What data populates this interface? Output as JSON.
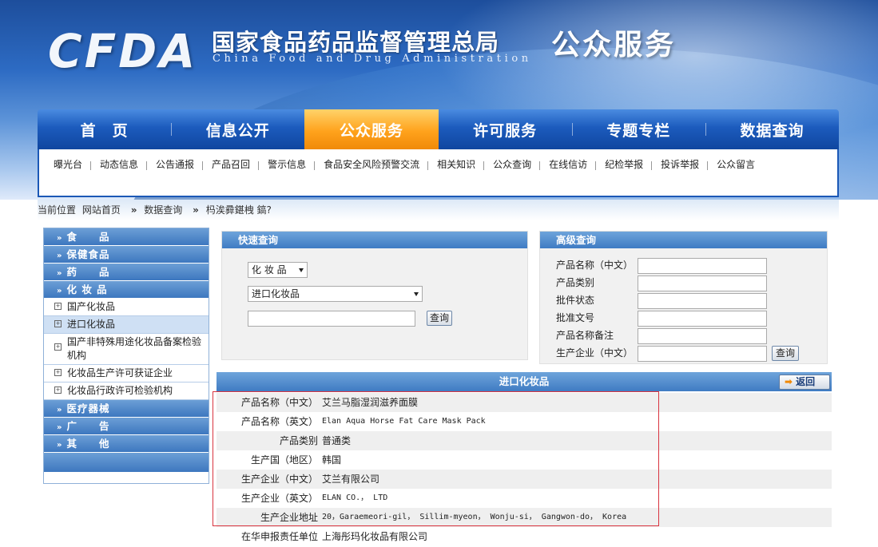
{
  "header": {
    "logo_text": "CFDA",
    "agency_cn": "国家食品药品监督管理总局",
    "agency_en": "China Food and Drug Administration",
    "section_title": "公众服务"
  },
  "main_nav": [
    {
      "label": "首　页",
      "active": false
    },
    {
      "label": "信息公开",
      "active": false
    },
    {
      "label": "公众服务",
      "active": true
    },
    {
      "label": "许可服务",
      "active": false
    },
    {
      "label": "专题专栏",
      "active": false
    },
    {
      "label": "数据查询",
      "active": false
    }
  ],
  "sub_nav": [
    "曝光台",
    "动态信息",
    "公告通报",
    "产品召回",
    "警示信息",
    "食品安全风险预警交流",
    "相关知识",
    "公众查询",
    "在线信访",
    "纪检举报",
    "投诉举报",
    "公众留言"
  ],
  "breadcrumb": {
    "prefix": "当前位置",
    "items": [
      "网站首页",
      "数据查询",
      "杩涘彛鍖栧  鎬?"
    ],
    "separator": "»"
  },
  "sidebar": {
    "categories": [
      {
        "label": "食　　品"
      },
      {
        "label": "保健食品"
      },
      {
        "label": "药　　品"
      },
      {
        "label": "化 妆 品"
      }
    ],
    "sub_items": [
      {
        "label": "国产化妆品",
        "active": false
      },
      {
        "label": "进口化妆品",
        "active": true
      },
      {
        "label": "国产非特殊用途化妆品备案检验机构",
        "active": false
      },
      {
        "label": "化妆品生产许可获证企业",
        "active": false
      },
      {
        "label": "化妆品行政许可检验机构",
        "active": false
      }
    ],
    "categories_after": [
      {
        "label": "医疗器械"
      },
      {
        "label": "广　　告"
      },
      {
        "label": "其　　他"
      }
    ]
  },
  "quick_search": {
    "title": "快速查询",
    "category_select": "化 妆 品",
    "type_select": "进口化妆品",
    "search_value": "",
    "search_button": "查询"
  },
  "advanced_search": {
    "title": "高级查询",
    "fields": [
      {
        "label": "产品名称（中文）",
        "value": ""
      },
      {
        "label": "产品类别",
        "value": ""
      },
      {
        "label": "批件状态",
        "value": ""
      },
      {
        "label": "批准文号",
        "value": ""
      },
      {
        "label": "产品名称备注",
        "value": ""
      },
      {
        "label": "生产企业（中文）",
        "value": ""
      }
    ],
    "search_button": "查询"
  },
  "detail": {
    "title": "进口化妆品",
    "back_button": "返回",
    "rows": [
      {
        "label": "产品名称（中文）",
        "value": "艾兰马脂湿润滋养面膜",
        "mono": false
      },
      {
        "label": "产品名称（英文）",
        "value": "Elan Aqua Horse Fat Care Mask Pack",
        "mono": true
      },
      {
        "label": "产品类别",
        "value": "普通类",
        "mono": false
      },
      {
        "label": "生产国（地区）",
        "value": "韩国",
        "mono": false
      },
      {
        "label": "生产企业（中文）",
        "value": "艾兰有限公司",
        "mono": false
      },
      {
        "label": "生产企业（英文）",
        "value": "ELAN CO.， LTD",
        "mono": true
      },
      {
        "label": "生产企业地址",
        "value": "20，Garaemeori-gil， Sillim-myeon， Wonju-si， Gangwon-do， Korea",
        "mono": true
      },
      {
        "label": "在华申报责任单位",
        "value": "上海彤玛化妆品有限公司",
        "mono": false
      }
    ]
  },
  "colors": {
    "nav_blue": "#1c5bbd",
    "nav_active_orange": "#ffa21c",
    "panel_header_blue": "#3f7bc3",
    "highlight_red": "#d9343f"
  }
}
